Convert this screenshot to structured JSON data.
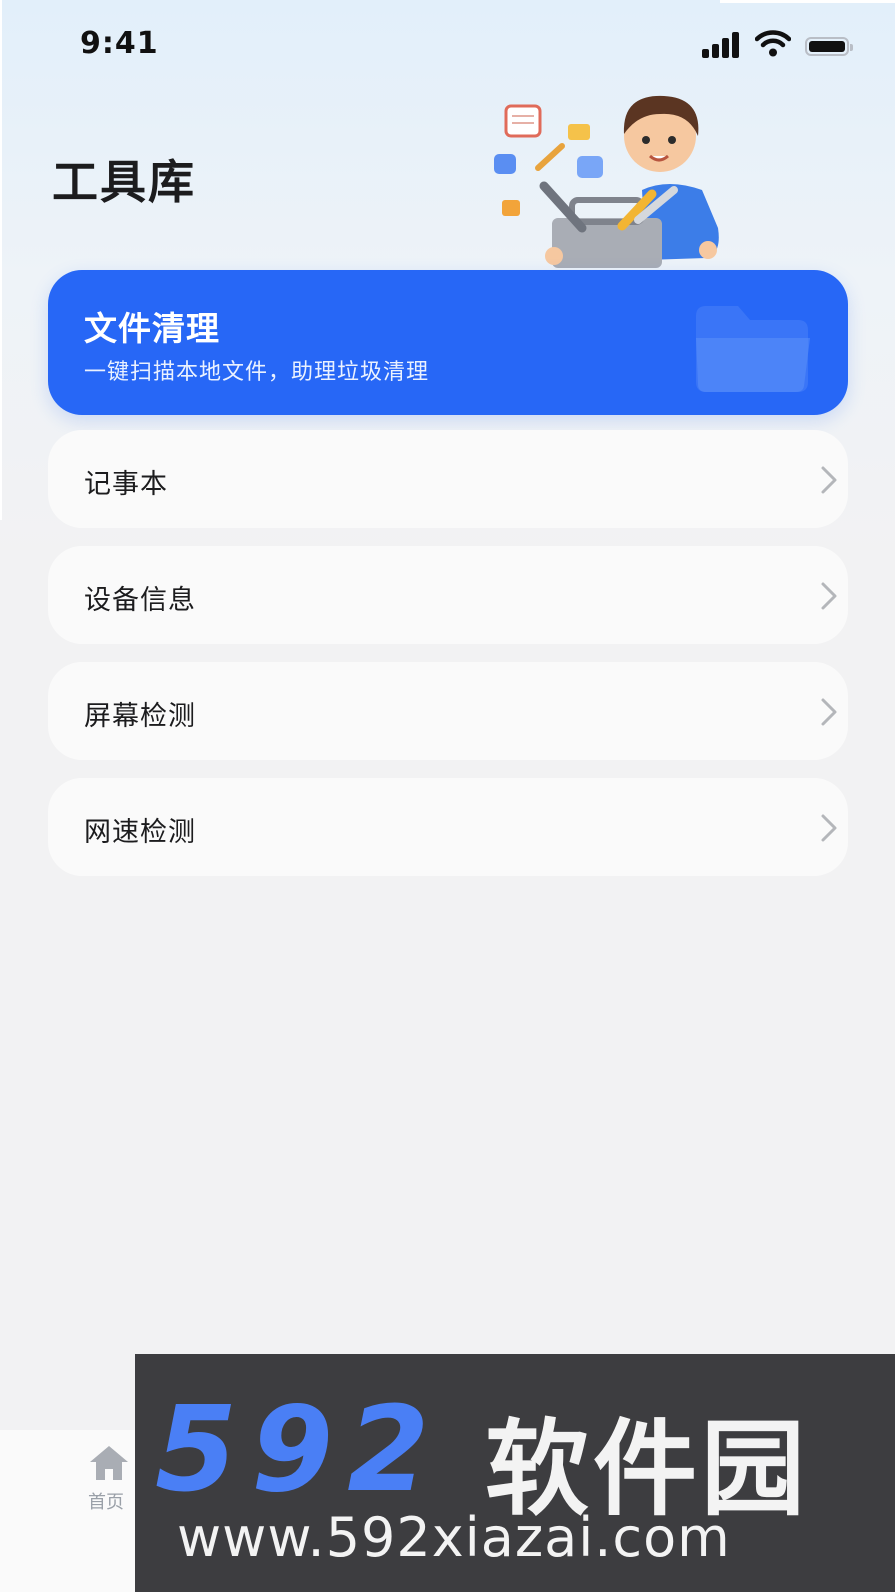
{
  "status_bar": {
    "time": "9:41"
  },
  "header": {
    "title": "工具库"
  },
  "hero_card": {
    "title": "文件清理",
    "subtitle": "一键扫描本地文件，助理垃圾清理"
  },
  "menu": {
    "items": [
      {
        "label": "记事本"
      },
      {
        "label": "设备信息"
      },
      {
        "label": "屏幕检测"
      },
      {
        "label": "网速检测"
      }
    ]
  },
  "tab_bar": {
    "home_label": "首页"
  },
  "watermark": {
    "brand_number": "592",
    "brand_name": "软件园",
    "url": "www.592xiazai.com"
  },
  "colors": {
    "accent": "#2767f6",
    "card_bg": "#fafafa",
    "page_bg": "#f2f2f3",
    "watermark_bg": "#3d3d40",
    "watermark_blue": "#4a7ff5"
  }
}
